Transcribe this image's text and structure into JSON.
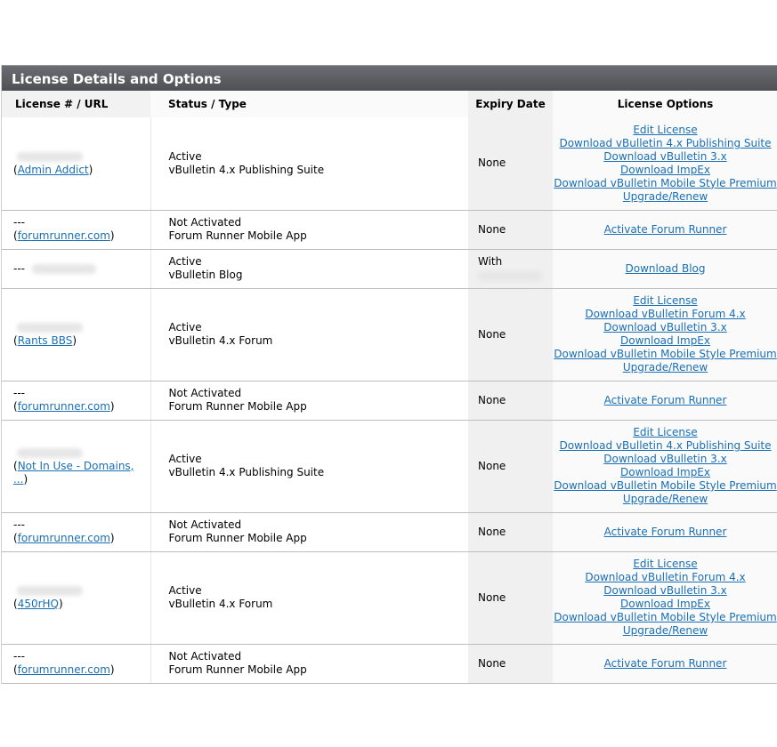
{
  "panel": {
    "title": "License Details and Options"
  },
  "columns": [
    "License # / URL",
    "Status / Type",
    "Expiry Date",
    "License Options"
  ],
  "rows": [
    {
      "license_prefix": "",
      "url_prefix": "(",
      "url": "Admin Addict",
      "url_suffix": ")",
      "status": "Active",
      "type": "vBulletin 4.x Publishing Suite",
      "expiry": "None",
      "options": [
        "Edit License",
        "Download vBulletin 4.x Publishing Suite",
        "Download vBulletin 3.x",
        "Download ImpEx",
        "Download vBulletin Mobile Style Premium",
        "Upgrade/Renew"
      ]
    },
    {
      "license_prefix": "---",
      "url_prefix": "(",
      "url": "forumrunner.com",
      "url_suffix": ")",
      "status": "Not Activated",
      "type": "Forum Runner Mobile App",
      "expiry": "None",
      "options": [
        "Activate Forum Runner"
      ]
    },
    {
      "license_prefix": "---",
      "url_prefix": "",
      "url": "",
      "url_suffix": "",
      "status": "Active",
      "type": "vBulletin Blog",
      "expiry": "With",
      "options": [
        "Download Blog"
      ]
    },
    {
      "license_prefix": "",
      "url_prefix": "(",
      "url": "Rants BBS",
      "url_suffix": ")",
      "status": "Active",
      "type": "vBulletin 4.x Forum",
      "expiry": "None",
      "options": [
        "Edit License",
        "Download vBulletin Forum 4.x",
        "Download vBulletin 3.x",
        "Download ImpEx",
        "Download vBulletin Mobile Style Premium",
        "Upgrade/Renew"
      ]
    },
    {
      "license_prefix": "---",
      "url_prefix": "(",
      "url": "forumrunner.com",
      "url_suffix": ")",
      "status": "Not Activated",
      "type": "Forum Runner Mobile App",
      "expiry": "None",
      "options": [
        "Activate Forum Runner"
      ]
    },
    {
      "license_prefix": "",
      "url_prefix": "(",
      "url": "Not In Use - Domains, ...",
      "url_suffix": ")",
      "status": "Active",
      "type": "vBulletin 4.x Publishing Suite",
      "expiry": "None",
      "options": [
        "Edit License",
        "Download vBulletin 4.x Publishing Suite",
        "Download vBulletin 3.x",
        "Download ImpEx",
        "Download vBulletin Mobile Style Premium",
        "Upgrade/Renew"
      ]
    },
    {
      "license_prefix": "---",
      "url_prefix": "(",
      "url": "forumrunner.com",
      "url_suffix": ")",
      "status": "Not Activated",
      "type": "Forum Runner Mobile App",
      "expiry": "None",
      "options": [
        "Activate Forum Runner"
      ]
    },
    {
      "license_prefix": "",
      "url_prefix": "(",
      "url": "450rHQ",
      "url_suffix": ")",
      "status": "Active",
      "type": "vBulletin 4.x Forum",
      "expiry": "None",
      "options": [
        "Edit License",
        "Download vBulletin Forum 4.x",
        "Download vBulletin 3.x",
        "Download ImpEx",
        "Download vBulletin Mobile Style Premium",
        "Upgrade/Renew"
      ]
    },
    {
      "license_prefix": "---",
      "url_prefix": "(",
      "url": "forumrunner.com",
      "url_suffix": ")",
      "status": "Not Activated",
      "type": "Forum Runner Mobile App",
      "expiry": "None",
      "options": [
        "Activate Forum Runner"
      ]
    }
  ]
}
